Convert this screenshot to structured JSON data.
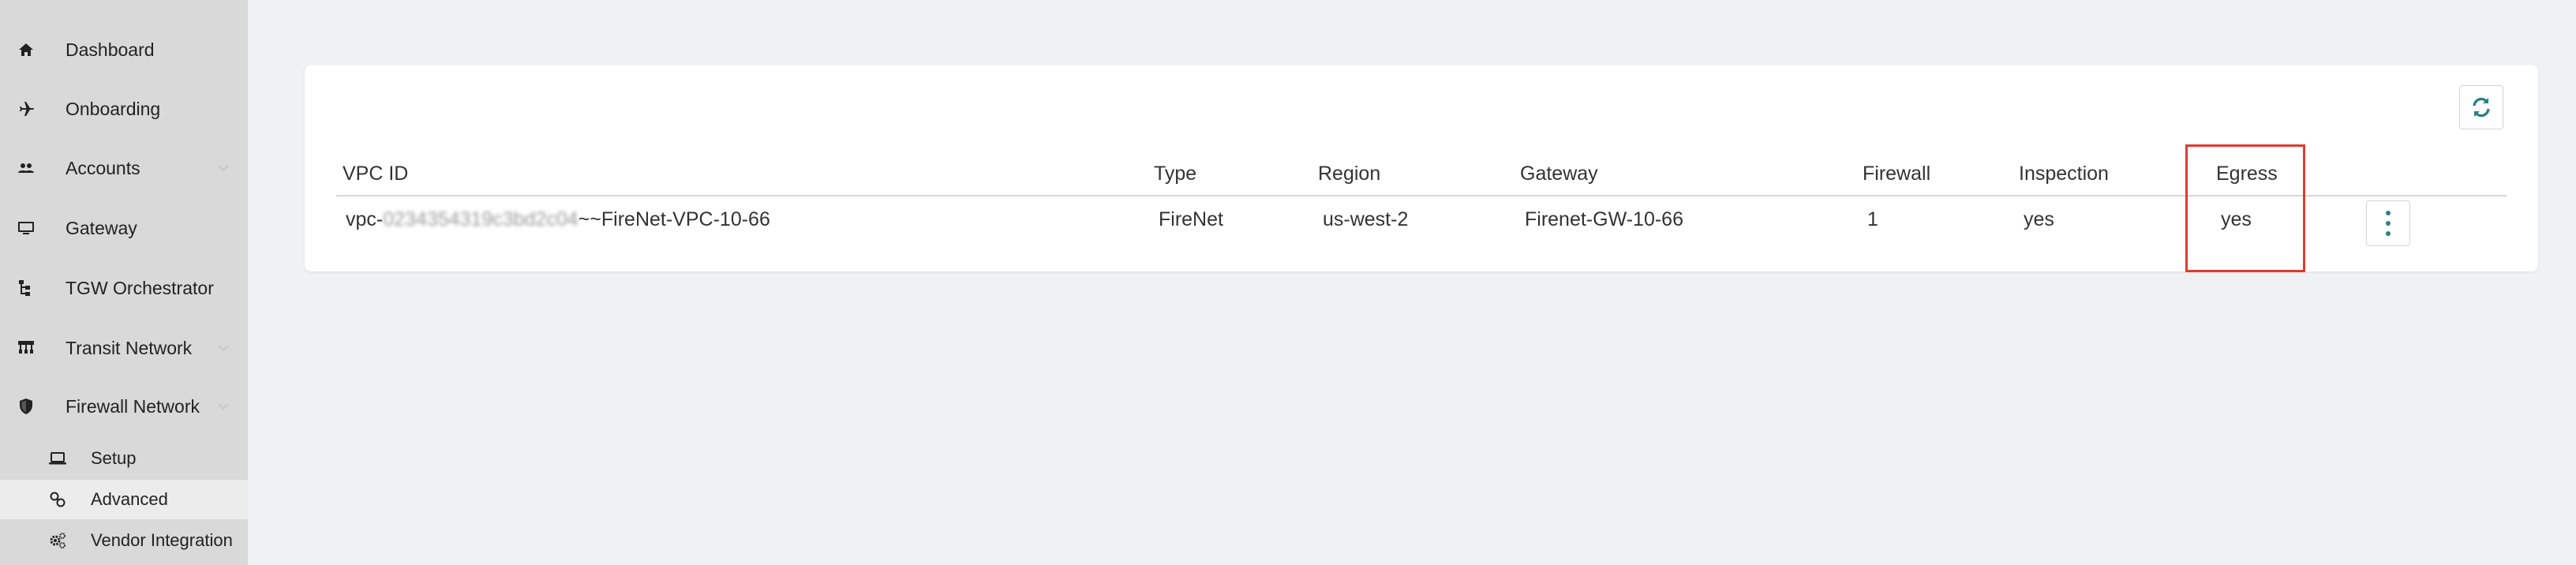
{
  "sidebar": {
    "items": [
      {
        "label": "Dashboard",
        "icon": "home-icon"
      },
      {
        "label": "Onboarding",
        "icon": "airplane-icon"
      },
      {
        "label": "Accounts",
        "icon": "users-icon"
      },
      {
        "label": "Gateway",
        "icon": "monitor-icon"
      },
      {
        "label": "TGW Orchestrator",
        "icon": "network-tree-icon"
      },
      {
        "label": "Transit Network",
        "icon": "hub-icon"
      },
      {
        "label": "Firewall Network",
        "icon": "shield-icon"
      }
    ],
    "sub_items": [
      {
        "label": "Setup",
        "icon": "laptop-icon"
      },
      {
        "label": "Advanced",
        "icon": "link-icon",
        "active": true
      },
      {
        "label": "Vendor Integration",
        "icon": "gears-icon"
      }
    ]
  },
  "table": {
    "headers": {
      "vpc_id": "VPC ID",
      "type": "Type",
      "region": "Region",
      "gateway": "Gateway",
      "firewall": "Firewall",
      "inspection": "Inspection",
      "egress": "Egress"
    },
    "rows": [
      {
        "vpc_prefix": "vpc-",
        "vpc_redacted": "0234354319c3bd2c04",
        "vpc_suffix": "~~FireNet-VPC-10-66",
        "type": "FireNet",
        "region": "us-west-2",
        "gateway": "Firenet-GW-10-66",
        "firewall": "1",
        "inspection": "yes",
        "egress": "yes"
      }
    ]
  },
  "icons": {
    "refresh": "refresh-icon",
    "row_menu": "kebab-menu-icon"
  },
  "colors": {
    "highlight": "#e03a2f",
    "refresh_icon": "#2a7f86",
    "sidebar_bg": "#d9d9d9",
    "page_bg": "#f0f1f2"
  }
}
